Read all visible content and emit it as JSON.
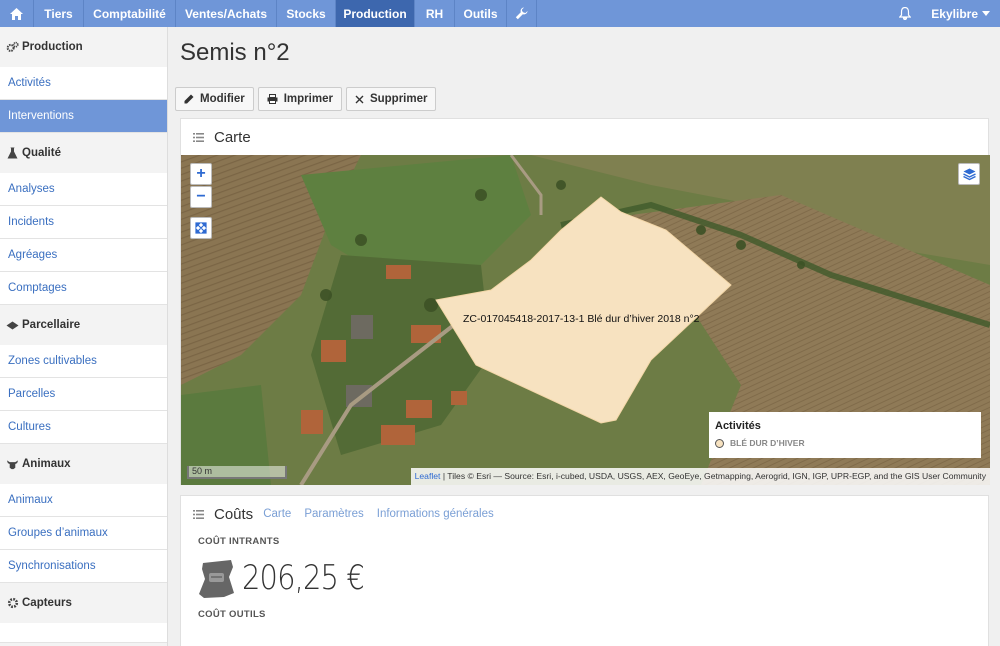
{
  "nav": {
    "items": [
      {
        "label": "Tiers"
      },
      {
        "label": "Comptabilité"
      },
      {
        "label": "Ventes/Achats"
      },
      {
        "label": "Stocks"
      },
      {
        "label": "Production"
      },
      {
        "label": "RH"
      },
      {
        "label": "Outils"
      }
    ],
    "active": "Production",
    "user": "Ekylibre",
    "colors": {
      "bar": "#6f96d8",
      "active": "#3d67ae"
    }
  },
  "sidebar": {
    "sections": [
      {
        "title": "Production",
        "icon": "gears-icon",
        "items": [
          {
            "label": "Activités"
          },
          {
            "label": "Interventions",
            "active": true
          }
        ]
      },
      {
        "title": "Qualité",
        "icon": "flask-icon",
        "items": [
          {
            "label": "Analyses"
          },
          {
            "label": "Incidents"
          },
          {
            "label": "Agréages"
          },
          {
            "label": "Comptages"
          }
        ]
      },
      {
        "title": "Parcellaire",
        "icon": "map-icon",
        "items": [
          {
            "label": "Zones cultivables"
          },
          {
            "label": "Parcelles"
          },
          {
            "label": "Cultures"
          }
        ]
      },
      {
        "title": "Animaux",
        "icon": "cow-icon",
        "items": [
          {
            "label": "Animaux"
          },
          {
            "label": "Groupes d’animaux"
          },
          {
            "label": "Synchronisations"
          }
        ]
      },
      {
        "title": "Capteurs",
        "icon": "gear-icon",
        "items": []
      }
    ]
  },
  "page": {
    "title": "Semis n°2",
    "actions": {
      "edit": "Modifier",
      "print": "Imprimer",
      "delete": "Supprimer"
    }
  },
  "map_panel": {
    "title": "Carte",
    "parcel_label": "ZC-017045418-2017-13-1 Blé dur d’hiver 2018 n°2",
    "parcel_color": "#f7e2c0",
    "legend": {
      "title": "Activités",
      "item": "BLÉ DUR D’HIVER"
    },
    "scale": "50 m",
    "attribution_link": "Leaflet",
    "attribution_text": " | Tiles © Esri — Source: Esri, i-cubed, USDA, USGS, AEX, GeoEye, Getmapping, Aerogrid, IGN, IGP, UPR-EGP, and the GIS User Community"
  },
  "costs_panel": {
    "title": "Coûts",
    "tabs": [
      {
        "label": "Carte"
      },
      {
        "label": "Paramètres"
      },
      {
        "label": "Informations générales"
      }
    ],
    "inputs_label": "COÛT INTRANTS",
    "inputs_value": "206,25 €",
    "tools_label": "COÛT OUTILS"
  }
}
